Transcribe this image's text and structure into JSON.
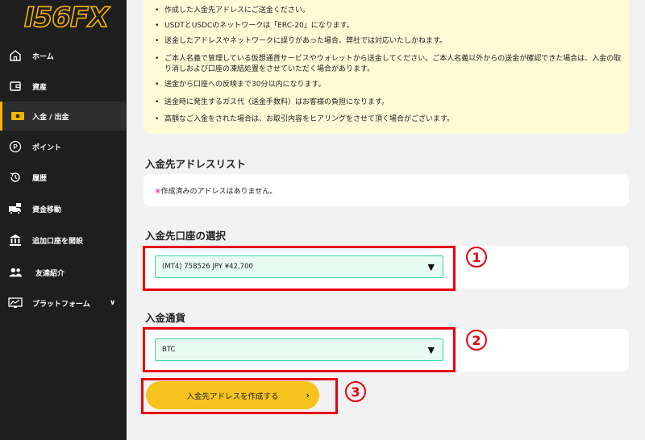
{
  "brand": {
    "logo_text": "I56FX",
    "accent": "#f5b400"
  },
  "sidebar": {
    "items": [
      {
        "label": "ホーム",
        "icon": "home-icon"
      },
      {
        "label": "資産",
        "icon": "wallet-icon"
      },
      {
        "label": "入金 / 出金",
        "icon": "cash-icon",
        "active": true
      },
      {
        "label": "ポイント",
        "icon": "point-icon"
      },
      {
        "label": "履歴",
        "icon": "history-icon"
      },
      {
        "label": "資金移動",
        "icon": "transfer-truck-icon"
      },
      {
        "label": "追加口座を開設",
        "icon": "bank-icon"
      },
      {
        "label": "友達紹介",
        "icon": "friends-icon"
      },
      {
        "label": "プラットフォーム",
        "icon": "monitor-chart-icon",
        "chevron": "∨"
      }
    ]
  },
  "notice": {
    "items": [
      "作成した入金先アドレスにご送金ください。",
      "USDTとUSDCのネットワークは「ERC-20」になります。",
      "送金したアドレスやネットワークに誤りがあった場合、弊社では対応いたしかねます。",
      "ご本人名義で管理している仮想通貨サービスやウォレットから送金してください。ご本人名義以外からの送金が確認できた場合は、入金の取り消しおよび口座の凍結処置をさせていただく場合があります。",
      "送金から口座への反映まで30分以内になります。",
      "送金時に発生するガス代（送金手数料）はお客様の負担になります。",
      "高額なご入金をされた場合は、お取引内容をヒアリングをさせて頂く場合がございます。"
    ]
  },
  "address_list": {
    "title": "入金先アドレスリスト",
    "empty_mark": "※",
    "empty_text": "作成済みのアドレスはありません。"
  },
  "account_select": {
    "title": "入金先口座の選択",
    "value": "(MT4) 758526 JPY ¥42,700",
    "step": "1"
  },
  "currency_select": {
    "title": "入金通貨",
    "value": "BTC",
    "step": "2"
  },
  "create_button": {
    "label": "入金先アドレスを作成する",
    "arrow": "›",
    "step": "3"
  }
}
